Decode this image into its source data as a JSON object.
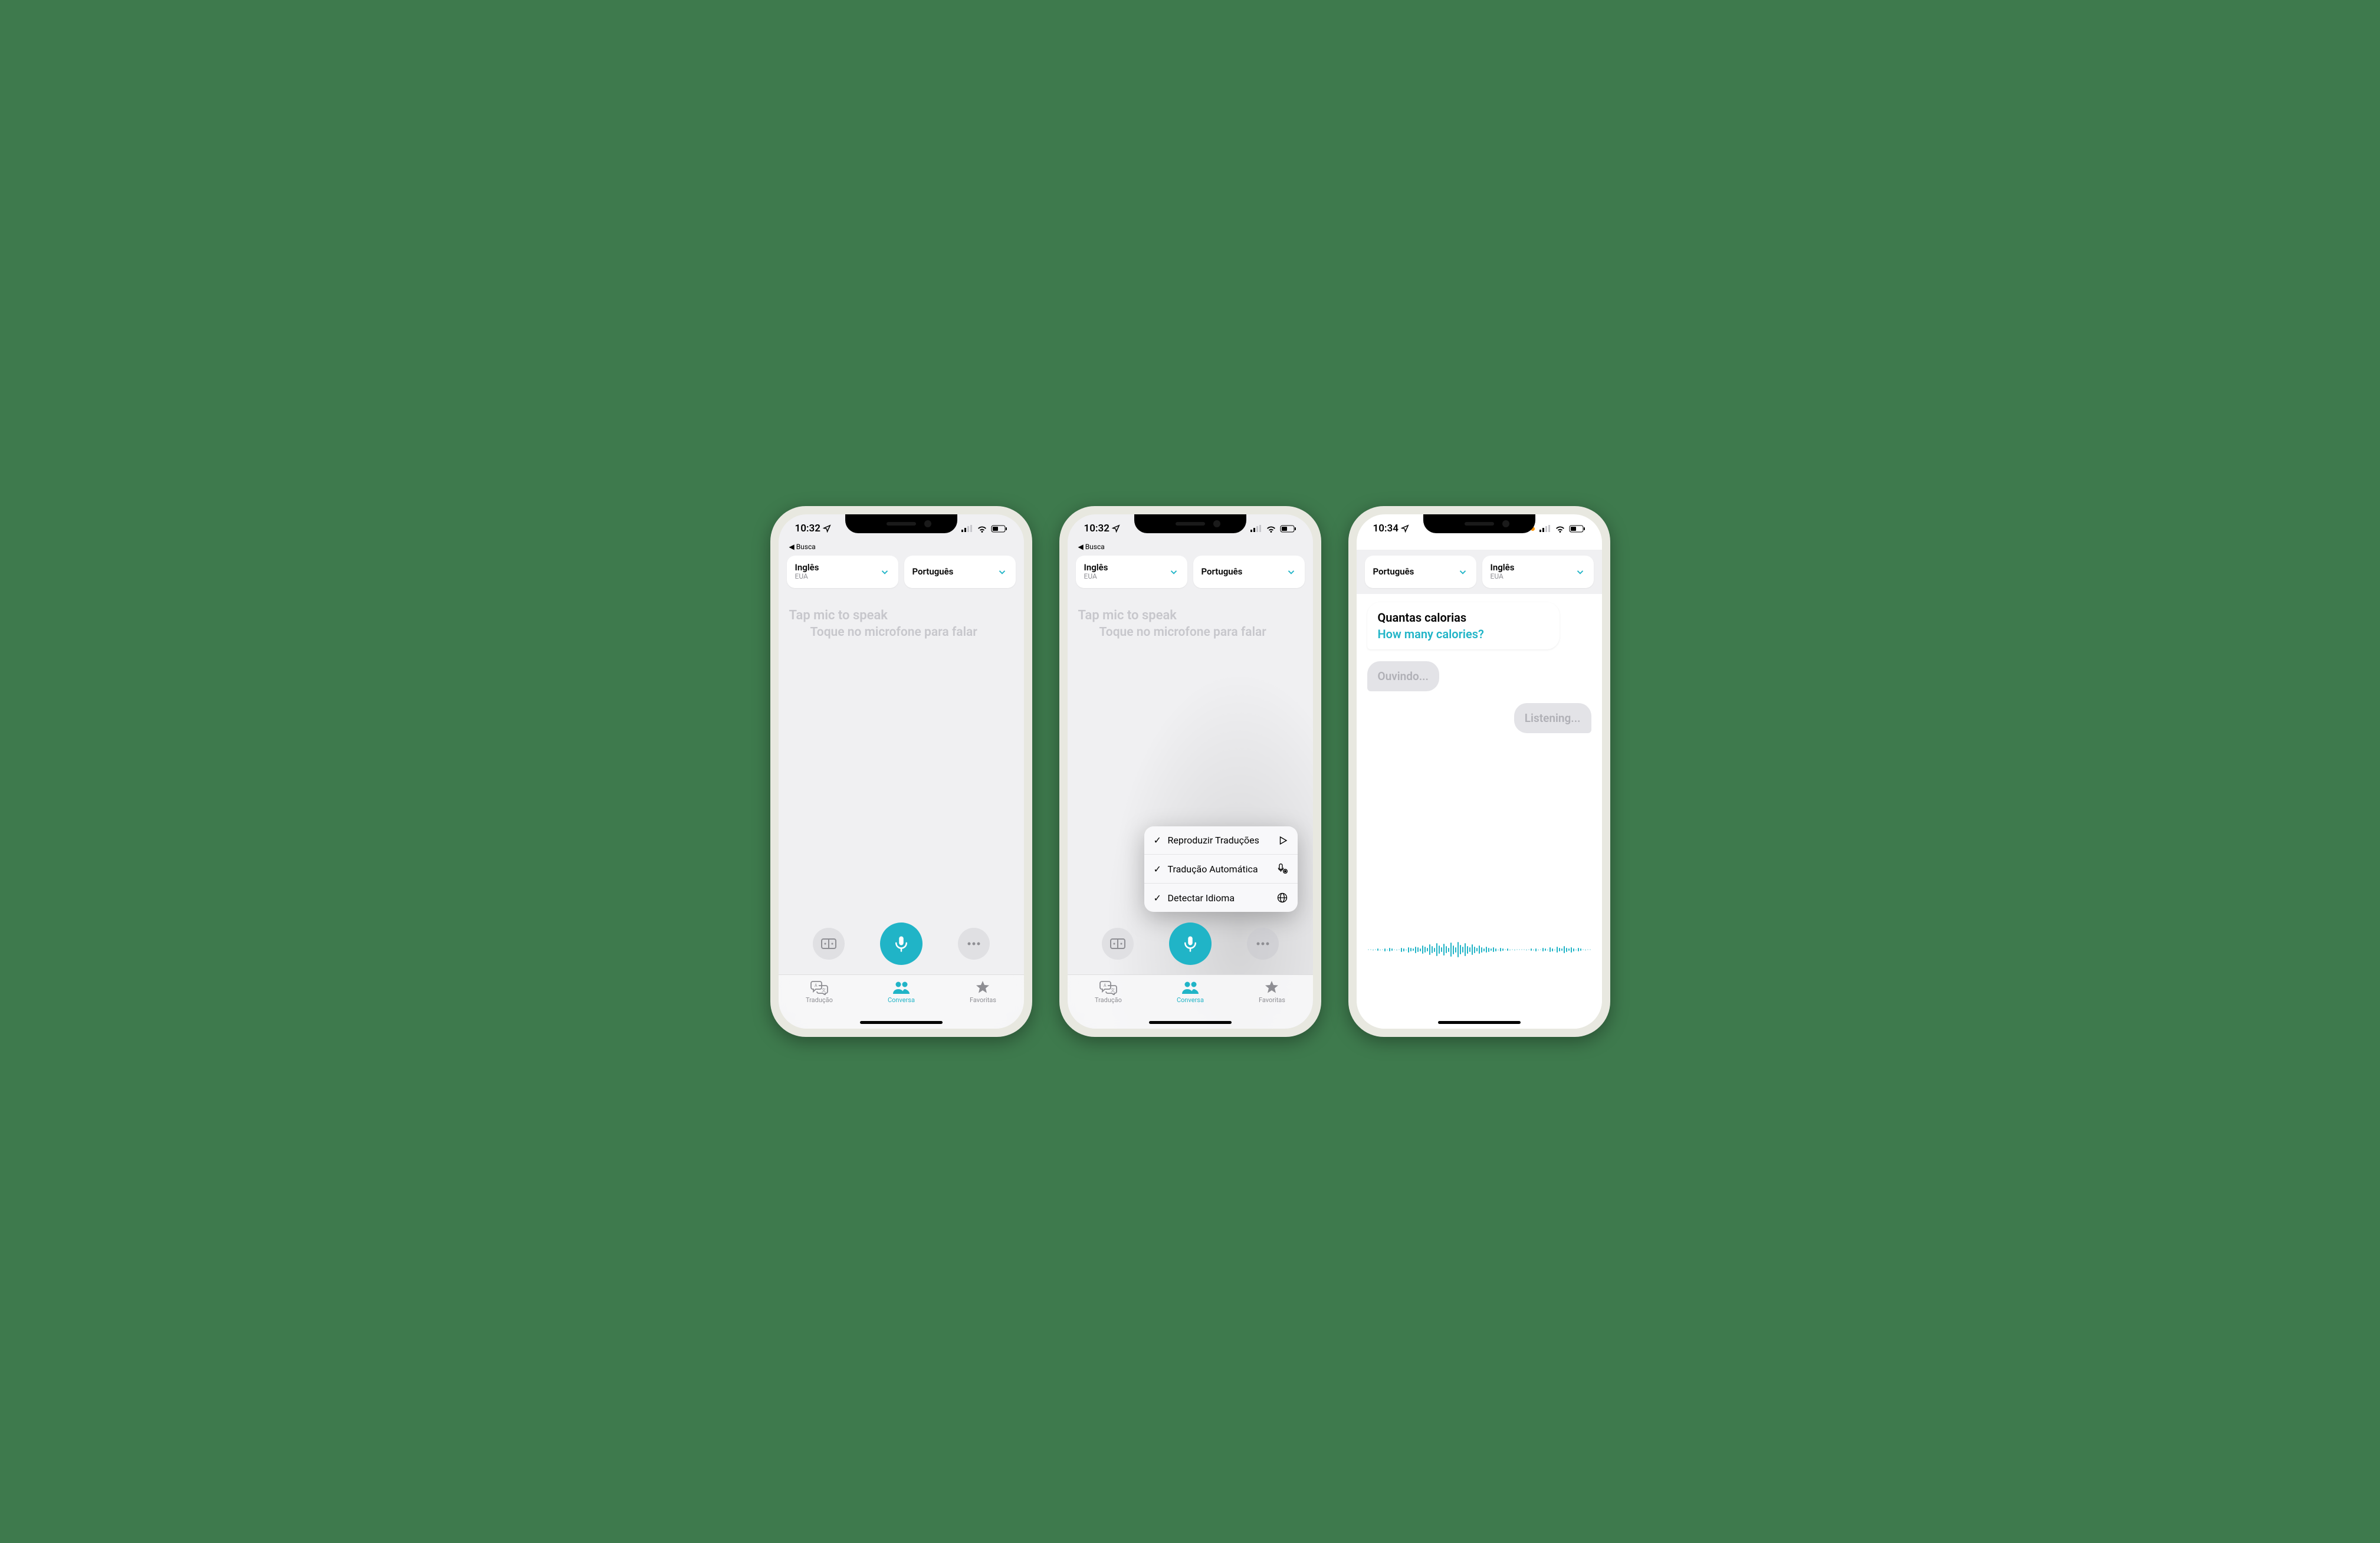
{
  "devices": [
    {
      "status": {
        "time": "10:32",
        "back_label": "◀ Busca",
        "has_orange_dot": false
      },
      "languages": {
        "left": {
          "name": "Inglês",
          "sub": "EUA"
        },
        "right": {
          "name": "Português",
          "sub": ""
        }
      },
      "hints": {
        "en": "Tap mic to speak",
        "pt": "Toque no microfone para falar"
      },
      "tabbar": {
        "items": [
          "Tradução",
          "Conversa",
          "Favoritas"
        ],
        "active_index": 1
      }
    },
    {
      "status": {
        "time": "10:32",
        "back_label": "◀ Busca",
        "has_orange_dot": false
      },
      "languages": {
        "left": {
          "name": "Inglês",
          "sub": "EUA"
        },
        "right": {
          "name": "Português",
          "sub": ""
        }
      },
      "hints": {
        "en": "Tap mic to speak",
        "pt": "Toque no microfone para falar"
      },
      "menu": [
        {
          "checked": true,
          "label": "Reproduzir Traduções",
          "icon": "play"
        },
        {
          "checked": true,
          "label": "Tradução Automática",
          "icon": "mic-gear"
        },
        {
          "checked": true,
          "label": "Detectar Idioma",
          "icon": "globe"
        }
      ],
      "tabbar": {
        "items": [
          "Tradução",
          "Conversa",
          "Favoritas"
        ],
        "active_index": 1
      }
    },
    {
      "status": {
        "time": "10:34",
        "back_label": "",
        "has_orange_dot": true
      },
      "languages": {
        "left": {
          "name": "Português",
          "sub": ""
        },
        "right": {
          "name": "Inglês",
          "sub": "EUA"
        }
      },
      "conversation": {
        "bubble": {
          "src": "Quantas calorias",
          "dst": "How many calories?"
        },
        "listening_left": "Ouvindo...",
        "listening_right": "Listening..."
      }
    }
  ],
  "colors": {
    "accent": "#20b4c7"
  }
}
